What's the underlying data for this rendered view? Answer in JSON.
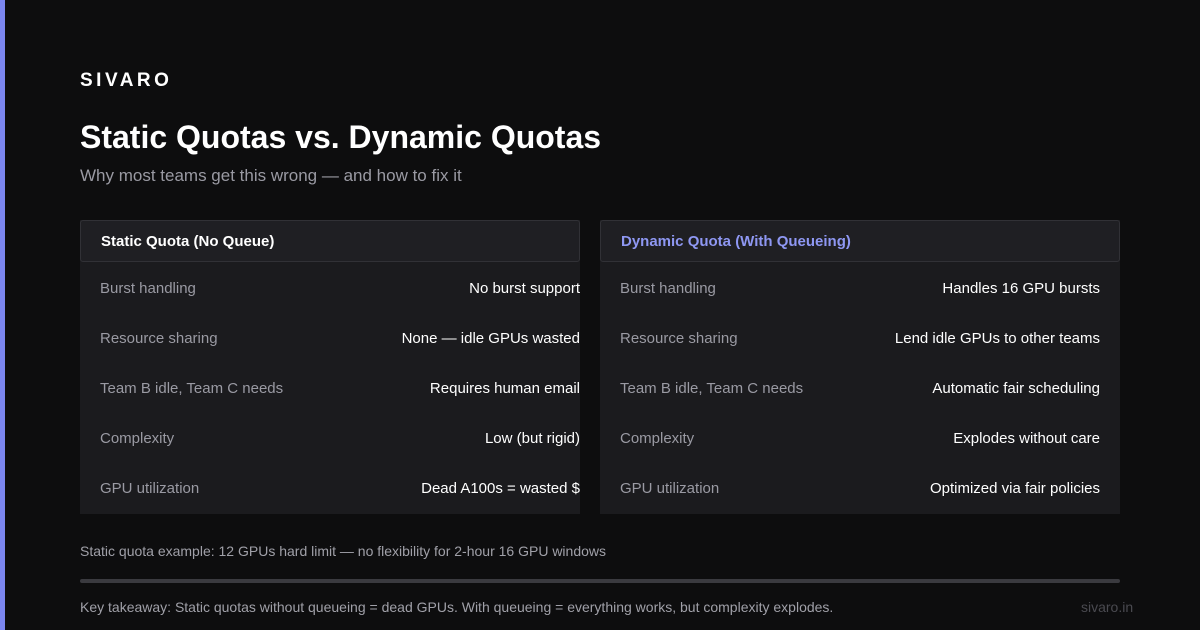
{
  "brand": "SIVARO",
  "title": "Static Quotas vs. Dynamic Quotas",
  "subtitle": "Why most teams get this wrong — and how to fix it",
  "colors": {
    "accent": "#7b86ef",
    "dynamic_header": "#8e97f2",
    "background": "#0d0d0e",
    "panel": "#1b1b1e"
  },
  "static_panel": {
    "header": "Static Quota (No Queue)",
    "rows": [
      {
        "label": "Burst handling",
        "value": "No burst support"
      },
      {
        "label": "Resource sharing",
        "value": "None — idle GPUs wasted"
      },
      {
        "label": "Team B idle, Team C needs",
        "value": "Requires human email"
      },
      {
        "label": "Complexity",
        "value": "Low (but rigid)"
      },
      {
        "label": "GPU utilization",
        "value": "Dead A100s = wasted $"
      }
    ]
  },
  "dynamic_panel": {
    "header": "Dynamic Quota (With Queueing)",
    "rows": [
      {
        "label": "Burst handling",
        "value": "Handles 16 GPU bursts"
      },
      {
        "label": "Resource sharing",
        "value": "Lend idle GPUs to other teams"
      },
      {
        "label": "Team B idle, Team C needs",
        "value": "Automatic fair scheduling"
      },
      {
        "label": "Complexity",
        "value": "Explodes without care"
      },
      {
        "label": "GPU utilization",
        "value": "Optimized via fair policies"
      }
    ]
  },
  "example": "Static quota example: 12 GPUs hard limit — no flexibility for 2-hour 16 GPU windows",
  "takeaway": "Key takeaway: Static quotas without queueing = dead GPUs. With queueing = everything works, but complexity explodes.",
  "site": "sivaro.in"
}
